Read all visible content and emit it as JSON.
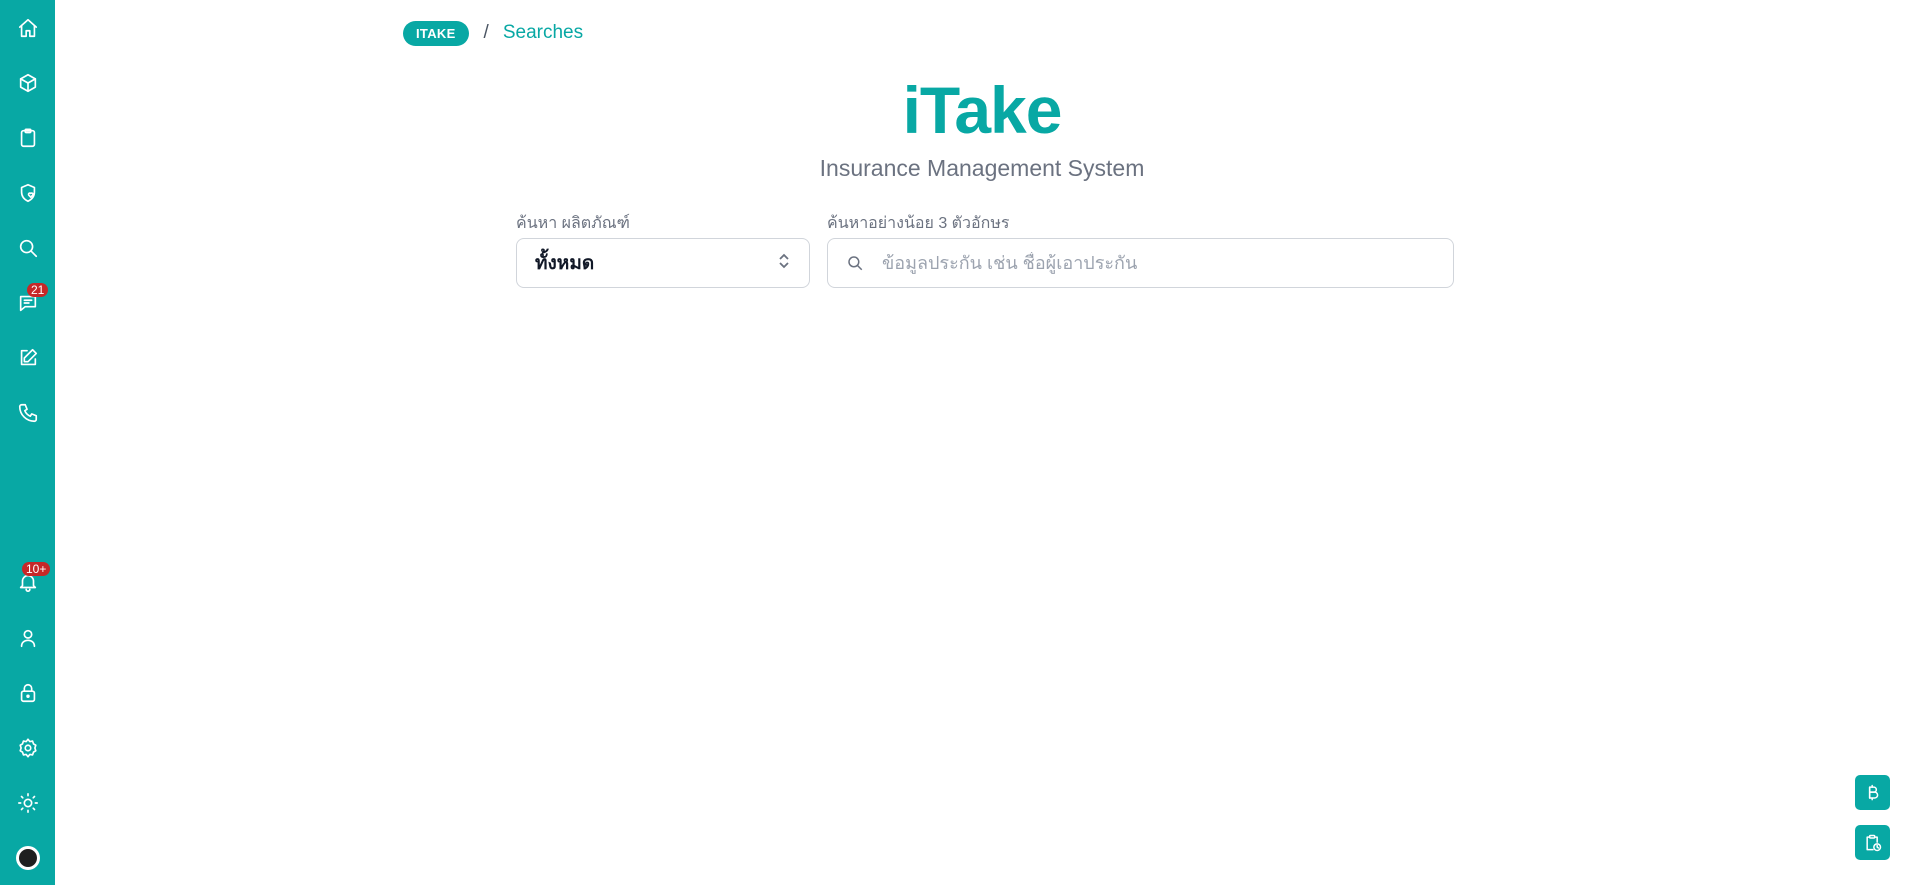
{
  "sidebar": {
    "items": [
      {
        "icon": "home-icon"
      },
      {
        "icon": "box-icon"
      },
      {
        "icon": "clipboard-icon"
      },
      {
        "icon": "shield-heart-icon"
      },
      {
        "icon": "search-icon"
      },
      {
        "icon": "message-icon",
        "badge": "21"
      },
      {
        "icon": "edit-icon"
      },
      {
        "icon": "phone-icon"
      },
      {
        "icon": "bell-icon",
        "badge": "10+"
      },
      {
        "icon": "user-icon"
      },
      {
        "icon": "lock-icon"
      },
      {
        "icon": "gear-icon"
      },
      {
        "icon": "sun-icon"
      },
      {
        "icon": "avatar-icon"
      }
    ]
  },
  "breadcrumb": {
    "root": "ITAKE",
    "separator": "/",
    "current": "Searches"
  },
  "brand": {
    "title": "iTake",
    "subtitle": "Insurance Management System"
  },
  "search_form": {
    "product_label": "ค้นหา ผลิตภัณฑ์",
    "product_value": "ทั้งหมด",
    "query_label": "ค้นหาอย่างน้อย 3 ตัวอักษร",
    "query_placeholder": "ข้อมูลประกัน เช่น ชื่อผู้เอาประกัน",
    "query_value": ""
  },
  "floating_actions": [
    {
      "icon": "baht-icon"
    },
    {
      "icon": "clipboard-clock-icon"
    }
  ],
  "colors": {
    "accent": "#08a8a4",
    "badge": "#c62828"
  }
}
